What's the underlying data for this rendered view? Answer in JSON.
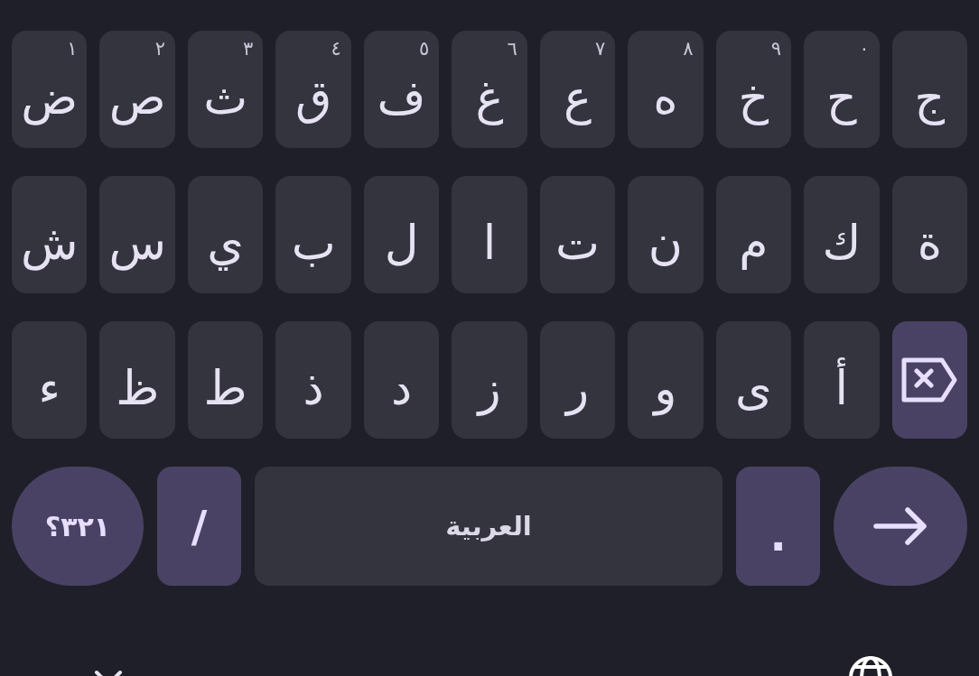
{
  "keyboard": {
    "rows": [
      {
        "keys": [
          {
            "kind": "letter",
            "label": "ج"
          },
          {
            "kind": "letter",
            "label": "ح",
            "hint": "٠"
          },
          {
            "kind": "letter",
            "label": "خ",
            "hint": "٩"
          },
          {
            "kind": "letter",
            "label": "ه",
            "hint": "٨"
          },
          {
            "kind": "letter",
            "label": "ع",
            "hint": "٧"
          },
          {
            "kind": "letter",
            "label": "غ",
            "hint": "٦"
          },
          {
            "kind": "letter",
            "label": "ف",
            "hint": "٥"
          },
          {
            "kind": "letter",
            "label": "ق",
            "hint": "٤"
          },
          {
            "kind": "letter",
            "label": "ث",
            "hint": "٣"
          },
          {
            "kind": "letter",
            "label": "ص",
            "hint": "٢"
          },
          {
            "kind": "letter",
            "label": "ض",
            "hint": "١"
          }
        ]
      },
      {
        "keys": [
          {
            "kind": "letter",
            "label": "ة"
          },
          {
            "kind": "letter",
            "label": "ك"
          },
          {
            "kind": "letter",
            "label": "م"
          },
          {
            "kind": "letter",
            "label": "ن"
          },
          {
            "kind": "letter",
            "label": "ت"
          },
          {
            "kind": "letter",
            "label": "ا"
          },
          {
            "kind": "letter",
            "label": "ل"
          },
          {
            "kind": "letter",
            "label": "ب"
          },
          {
            "kind": "letter",
            "label": "ي"
          },
          {
            "kind": "letter",
            "label": "س"
          },
          {
            "kind": "letter",
            "label": "ش"
          }
        ]
      },
      {
        "keys": [
          {
            "kind": "backspace"
          },
          {
            "kind": "letter",
            "label": "أ"
          },
          {
            "kind": "letter",
            "label": "ى"
          },
          {
            "kind": "letter",
            "label": "و"
          },
          {
            "kind": "letter",
            "label": "ر"
          },
          {
            "kind": "letter",
            "label": "ز"
          },
          {
            "kind": "letter",
            "label": "د"
          },
          {
            "kind": "letter",
            "label": "ذ"
          },
          {
            "kind": "letter",
            "label": "ط"
          },
          {
            "kind": "letter",
            "label": "ظ"
          },
          {
            "kind": "letter",
            "label": "ء"
          }
        ]
      },
      {
        "keys": [
          {
            "kind": "enter"
          },
          {
            "kind": "symbol",
            "label": "."
          },
          {
            "kind": "space",
            "label": "العربية"
          },
          {
            "kind": "symbol",
            "label": "/"
          },
          {
            "kind": "mode",
            "label": "١٢٣؟"
          }
        ]
      }
    ]
  }
}
